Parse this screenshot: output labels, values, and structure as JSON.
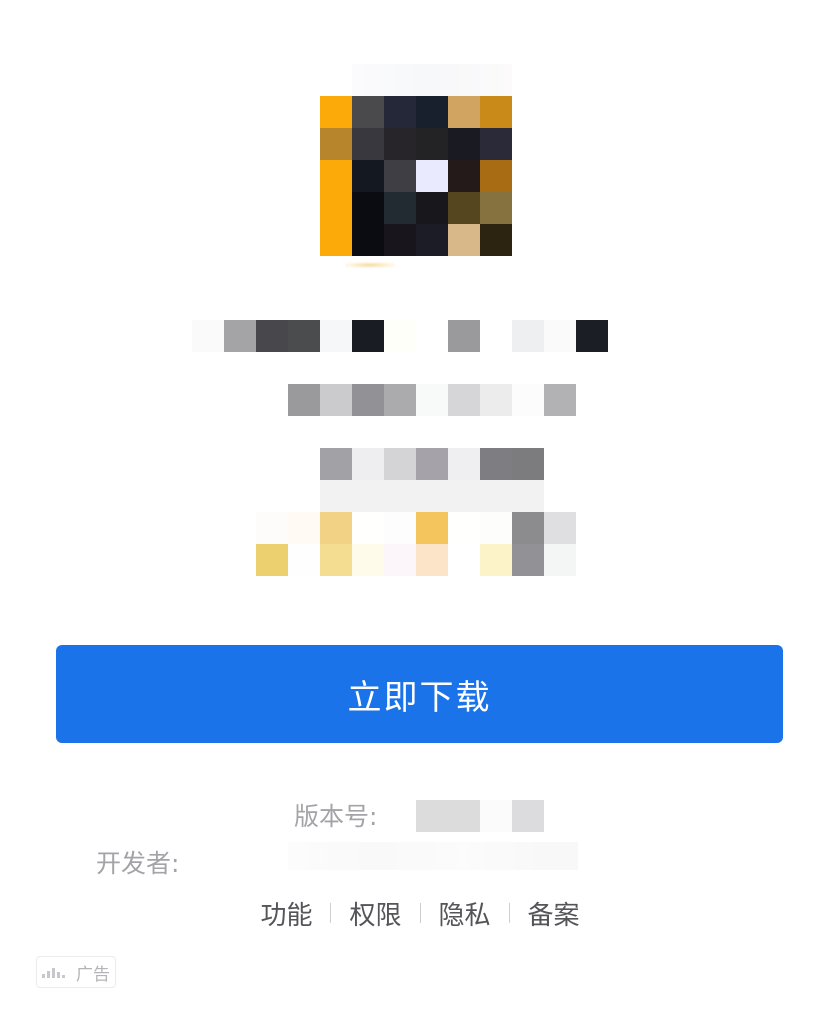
{
  "app_icon": {
    "rows": [
      [
        "#fcaa0a",
        "#4a4a4c",
        "#252838",
        "#18202e",
        "#d2a462",
        "#c98a1a"
      ],
      [
        "#b7852c",
        "#38383e",
        "#27242a",
        "#232326",
        "#1a1a22",
        "#2a2a38"
      ],
      [
        "#fcaa0a",
        "#141820",
        "#3e3e44",
        "#eaeaff",
        "#241a1a",
        "#a86c14"
      ],
      [
        "#fcaa0a",
        "#0a0c12",
        "#222a32",
        "#18181c",
        "#554620",
        "#86723e"
      ],
      [
        "#fcaa0a",
        "#0a0c12",
        "#18161c",
        "#1c1c26",
        "#d8b888",
        "#2c2410"
      ]
    ]
  },
  "app_name_mosaic": [
    "#fafafa",
    "#a4a4a6",
    "#48484c",
    "#4a4c4e",
    "#f6f7f9",
    "#1a1c24",
    "#fffffa",
    "#ffffff",
    "#9a9a9c",
    "#ffffff",
    "#eeeff1",
    "#fafafb",
    "#1c1e26"
  ],
  "subtitle_mosaic": [
    "#9a9a9c",
    "#cbcbcd",
    "#929296",
    "#ababad",
    "#f8f9f9",
    "#d6d6d8",
    "#ececed",
    "#fcfcfc",
    "#b2b2b4"
  ],
  "rating_mosaic_row1": [
    "#a2a2a6",
    "#eeeef0",
    "#d4d4d6",
    "#a5a2aa",
    "#efeff1",
    "#7e7e82",
    "#7c7c7e"
  ],
  "rating_mosaic_row2": [
    "#fefcfb",
    "#fffbf4",
    "#f2d386",
    "#fffffd",
    "#fefdfd",
    "#f4c55c",
    "#fffffe",
    "#fdfdfc",
    "#8c8c8e",
    "#dfdfe1"
  ],
  "rating_mosaic_row3": [
    "#ecd070",
    "#fefefe",
    "#f4dc90",
    "#fffbea",
    "#fcf6fa",
    "#fce4c8",
    "#ffffff",
    "#fcf4c8",
    "#929296",
    "#f4f6f6"
  ],
  "download_button": {
    "label": "立即下载"
  },
  "meta": {
    "version_label": "版本号:",
    "developer_label": "开发者:",
    "version_mosaic": [
      "#dcdcdd",
      "#dcdcdd",
      "#fbfbfb",
      "#dcdcde"
    ]
  },
  "links": [
    {
      "label": "功能"
    },
    {
      "label": "权限"
    },
    {
      "label": "隐私"
    },
    {
      "label": "备案"
    }
  ],
  "ad_badge": {
    "label": "广告"
  }
}
